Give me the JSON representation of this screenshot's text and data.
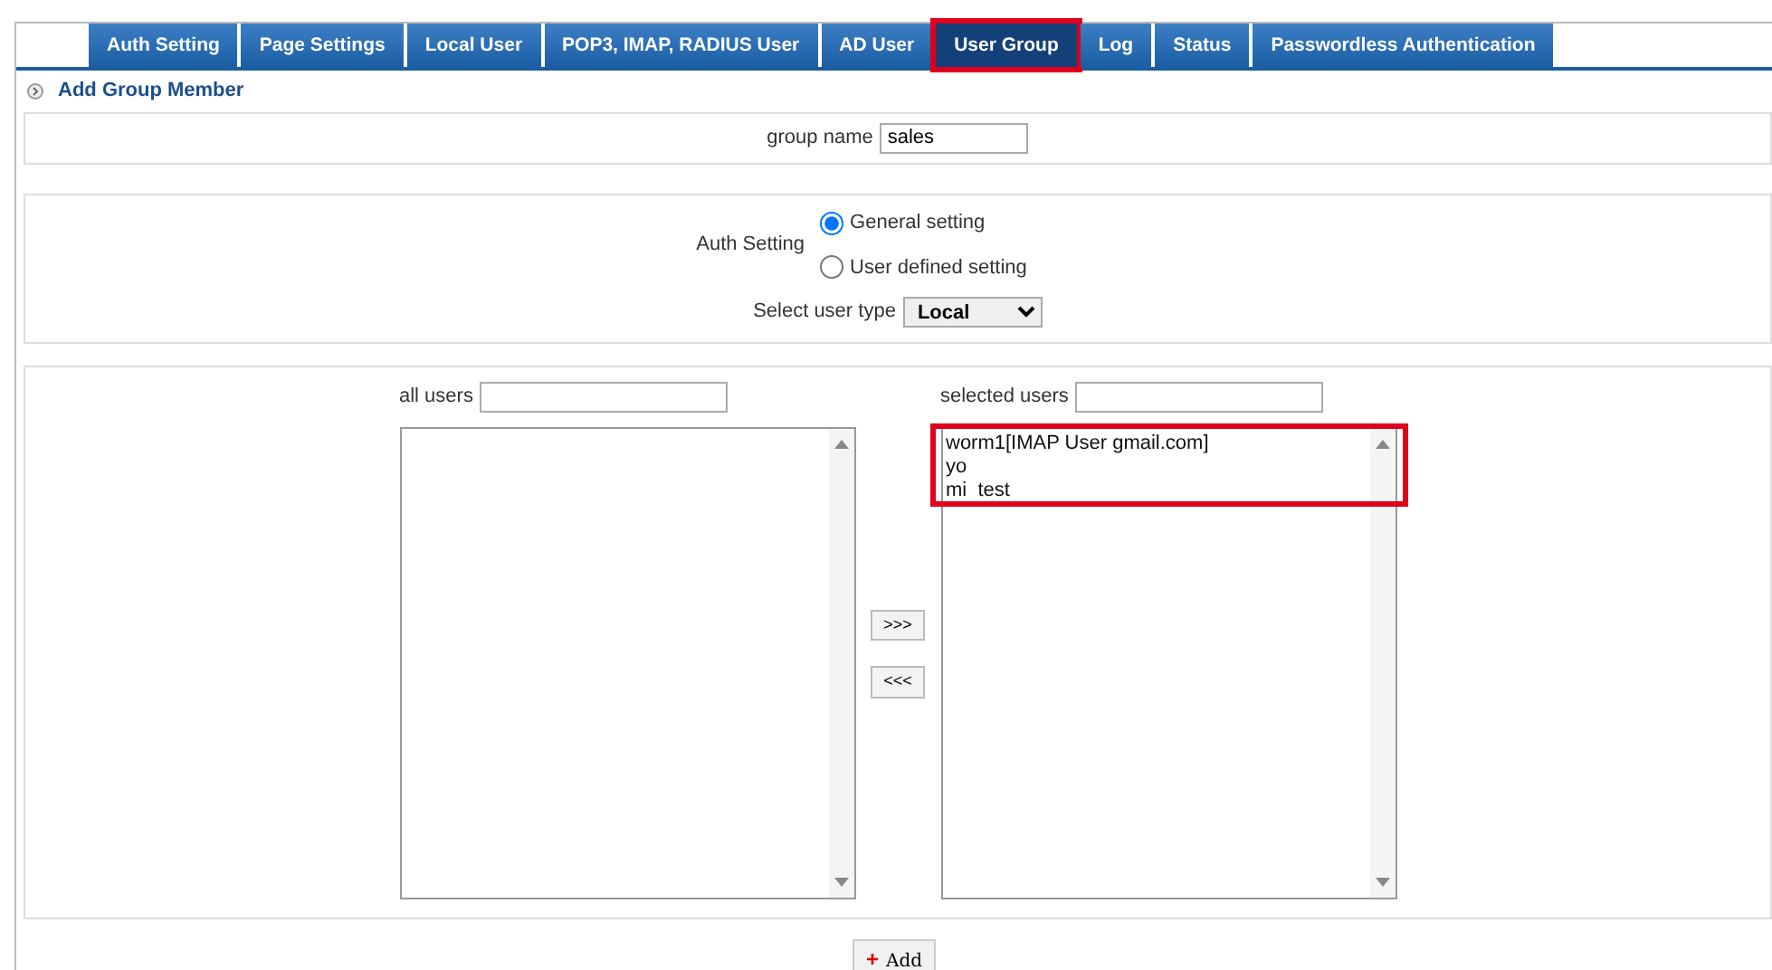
{
  "tabs": [
    {
      "label": "Auth Setting",
      "selected": false,
      "highlighted": false
    },
    {
      "label": "Page Settings",
      "selected": false,
      "highlighted": false
    },
    {
      "label": "Local User",
      "selected": false,
      "highlighted": false
    },
    {
      "label": "POP3, IMAP, RADIUS User",
      "selected": false,
      "highlighted": false
    },
    {
      "label": "AD User",
      "selected": false,
      "highlighted": false
    },
    {
      "label": "User Group",
      "selected": true,
      "highlighted": true
    },
    {
      "label": "Log",
      "selected": false,
      "highlighted": false
    },
    {
      "label": "Status",
      "selected": false,
      "highlighted": false
    },
    {
      "label": "Passwordless Authentication",
      "selected": false,
      "highlighted": false
    }
  ],
  "section_title": "Add Group Member",
  "group_name": {
    "label": "group name",
    "value": "sales"
  },
  "auth_setting": {
    "label": "Auth Setting",
    "options": [
      {
        "label": "General setting",
        "selected": true
      },
      {
        "label": "User defined setting",
        "selected": false
      }
    ]
  },
  "user_type": {
    "label": "Select user type",
    "value": "Local"
  },
  "all_users": {
    "label": "all users"
  },
  "selected_users": {
    "label": "selected users",
    "highlighted": true,
    "items": [
      "worm1[IMAP User gmail.com]",
      "yo",
      "mi  test"
    ]
  },
  "move_buttons": [
    ">>>",
    "<<<"
  ],
  "add_button": {
    "icon": "+",
    "label": "Add"
  }
}
